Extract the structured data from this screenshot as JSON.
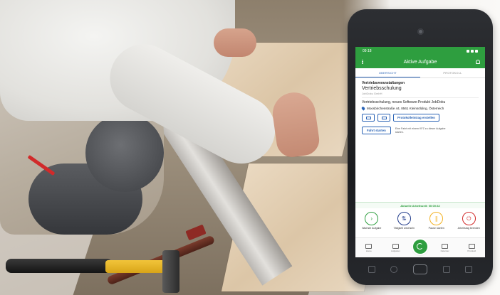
{
  "status_bar": {
    "time": "09:18"
  },
  "app_bar": {
    "title": "Aktive Aufgabe"
  },
  "tabs": [
    {
      "label": "ÜBERSICHT",
      "active": true
    },
    {
      "label": "PROTOKOLL",
      "active": false
    }
  ],
  "task": {
    "category": "Vertriebsveranstaltungen",
    "title": "Vertriebsschulung",
    "company": "JobDoku GmbH",
    "description": "Vertriebsschulung, neues Software-Produkt JobDoku",
    "address": "Moosbirchenstraße 44, 8561 Kleinsölding, Österreich"
  },
  "actions": {
    "protocol_button": "Protokolleintrag erstellen",
    "trip_button": "Fahrt starten",
    "trip_note": "Eine Fahrt mit einem KFZ zu dieser Aufgabe starten."
  },
  "worktime": {
    "label": "Aktuelle Arbeitszeit: 00:00:32"
  },
  "controls": [
    {
      "label": "Nächste Aufgabe",
      "symbol": "›",
      "color": "green"
    },
    {
      "label": "Tätigkeit wechseln",
      "symbol": "⇅",
      "color": "blue"
    },
    {
      "label": "Pause starten",
      "symbol": "∥",
      "color": "yellow"
    },
    {
      "label": "Arbeitstag beenden",
      "symbol": "⏻",
      "color": "red"
    }
  ],
  "bottom_nav": [
    {
      "label": "Home",
      "icon": "home-icon"
    },
    {
      "label": "Aufgaben",
      "icon": "tasks-icon"
    },
    {
      "label": "Kalender",
      "icon": "calendar-icon"
    },
    {
      "label": "Protokoll",
      "icon": "protocol-icon"
    }
  ],
  "colors": {
    "brand_green": "#2e9e3f",
    "accent_blue": "#2a63b5",
    "stop_red": "#d12a2a",
    "pause_yellow": "#f2b01e"
  }
}
